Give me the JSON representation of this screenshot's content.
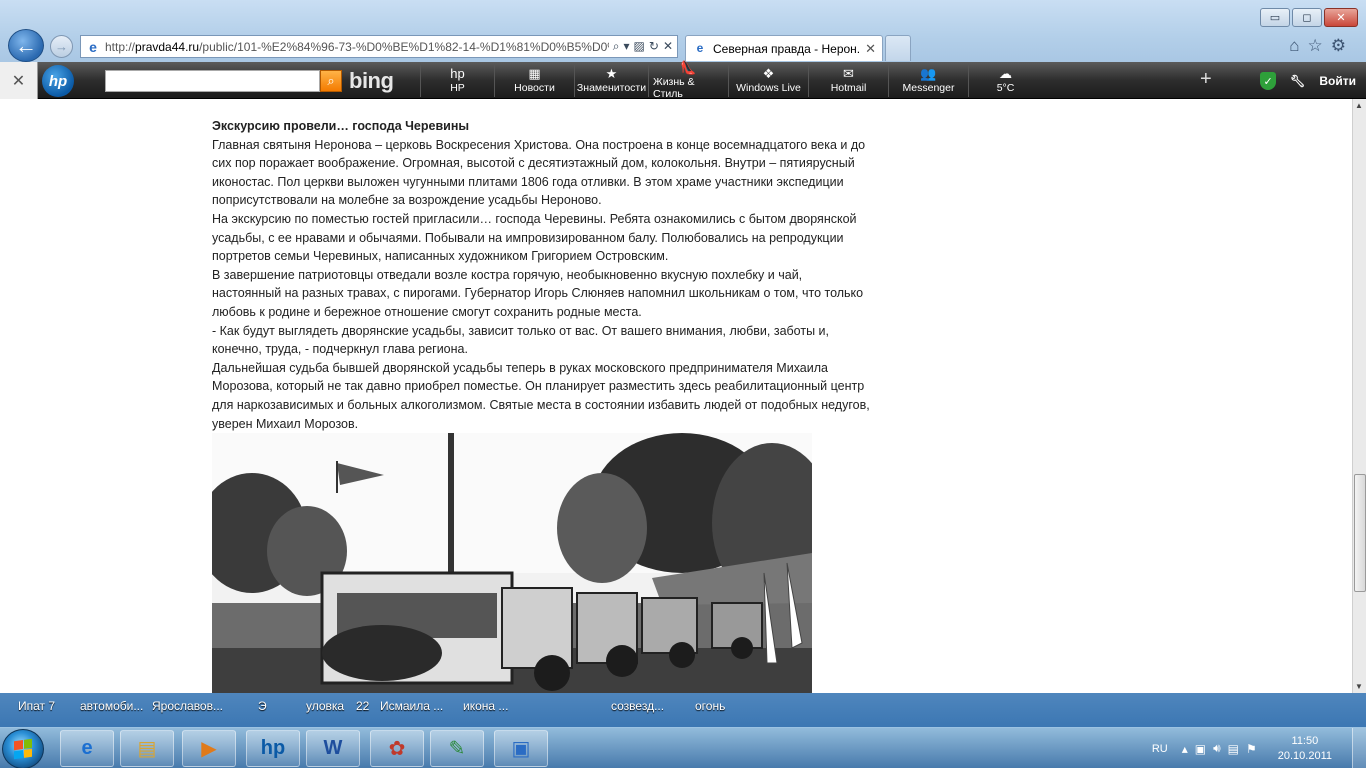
{
  "window": {
    "minimize": "▭",
    "maximize": "◻",
    "close": "✕"
  },
  "nav": {
    "back_icon": "arrow-left-icon",
    "forward_icon": "arrow-right-icon",
    "url_grey": "http://",
    "url_host": "pravda44.ru",
    "url_path": "/public/101-%E2%84%96-73-%D0%BE%D1%82-14-%D1%81%D0%B5%D0%",
    "tab_title": "Северная правда - Нерон...",
    "tab_close": "✕"
  },
  "toolbar": {
    "close": "✕",
    "hp_logo": "hp",
    "search_placeholder": "",
    "bing": "bing",
    "items": [
      {
        "label": "HP",
        "icon": "hp-icon",
        "glyph": "hp"
      },
      {
        "label": "Новости",
        "icon": "news-icon",
        "glyph": "▦"
      },
      {
        "label": "Знаменитости",
        "icon": "star-icon",
        "glyph": "★"
      },
      {
        "label": "Жизнь & Стиль",
        "icon": "shoe-icon",
        "glyph": "👠"
      },
      {
        "label": "Windows Live",
        "icon": "windows-icon",
        "glyph": "❖"
      },
      {
        "label": "Hotmail",
        "icon": "mail-icon",
        "glyph": "✉"
      },
      {
        "label": "Messenger",
        "icon": "messenger-icon",
        "glyph": "👥"
      },
      {
        "label": "5°C",
        "icon": "weather-icon",
        "glyph": "☁"
      }
    ],
    "plus": "+",
    "login": "Войти"
  },
  "article": {
    "heading": "Экскурсию провели… господа Черевины",
    "paragraphs": [
      "Главная святыня Неронова – церковь Воскресения Христова. Она построена в конце восемнадцатого века и до сих пор поражает воображение. Огромная, высотой с десятиэтажный дом, колокольня. Внутри – пятиярусный иконостас. Пол церкви выложен чугунными плитами 1806 года отливки. В этом храме участники экспедиции поприсутствовали на молебне за возрождение усадьбы Нероново.",
      "На экскурсию по поместью гостей пригласили… господа Черевины. Ребята ознакомились с бытом дворянской усадьбы, с ее нравами и обычаями. Побывали на импровизированном балу. Полюбовались на репродукции портретов семьи Черевиных, написанных художником Григорием Островским.",
      "В завершение патриотовцы отведали возле костра горячую, необыкновенно вкусную похлебку и чай, настоянный на разных травах, с пирогами. Губернатор Игорь Слюняев напомнил школьникам о том, что только любовь к родине и бережное отношение смогут сохранить родные места.",
      "- Как будут выглядеть дворянские усадьбы, зависит только от вас. От вашего внимания, любви, заботы и, конечно, труда, - подчеркнул глава региона.",
      "Дальнейшая судьба бывшей дворянской усадьбы теперь в руках московского предпринимателя Михаила Морозова, который не так давно приобрел поместье. Он планирует разместить здесь реабилитационный центр для наркозависимых и больных алкоголизмом. Святые места в состоянии избавить людей от подобных недугов, уверен Михаил Морозов."
    ]
  },
  "desktop_strip": [
    "Ипат 7",
    "автомоби...",
    "Ярославов...",
    "Э",
    "уловка",
    "22",
    "Исмаила ...",
    "икона ...",
    "созвезд...",
    "огонь"
  ],
  "taskbar": {
    "apps": [
      {
        "name": "internet-explorer",
        "glyph": "e",
        "color": "#1b6fd1"
      },
      {
        "name": "file-explorer",
        "glyph": "▤",
        "color": "#d9a531"
      },
      {
        "name": "media-player",
        "glyph": "▶",
        "color": "#e07a1a"
      },
      {
        "name": "hp-support",
        "glyph": "hp",
        "color": "#0b5aa6"
      },
      {
        "name": "word",
        "glyph": "W",
        "color": "#1e4e9e"
      },
      {
        "name": "messenger",
        "glyph": "✿",
        "color": "#c0392b"
      },
      {
        "name": "paint",
        "glyph": "✎",
        "color": "#2c8a3c"
      },
      {
        "name": "photo-viewer",
        "glyph": "▣",
        "color": "#2a6cc4"
      }
    ],
    "lang": "RU",
    "time": "11:50",
    "date": "20.10.2011"
  }
}
